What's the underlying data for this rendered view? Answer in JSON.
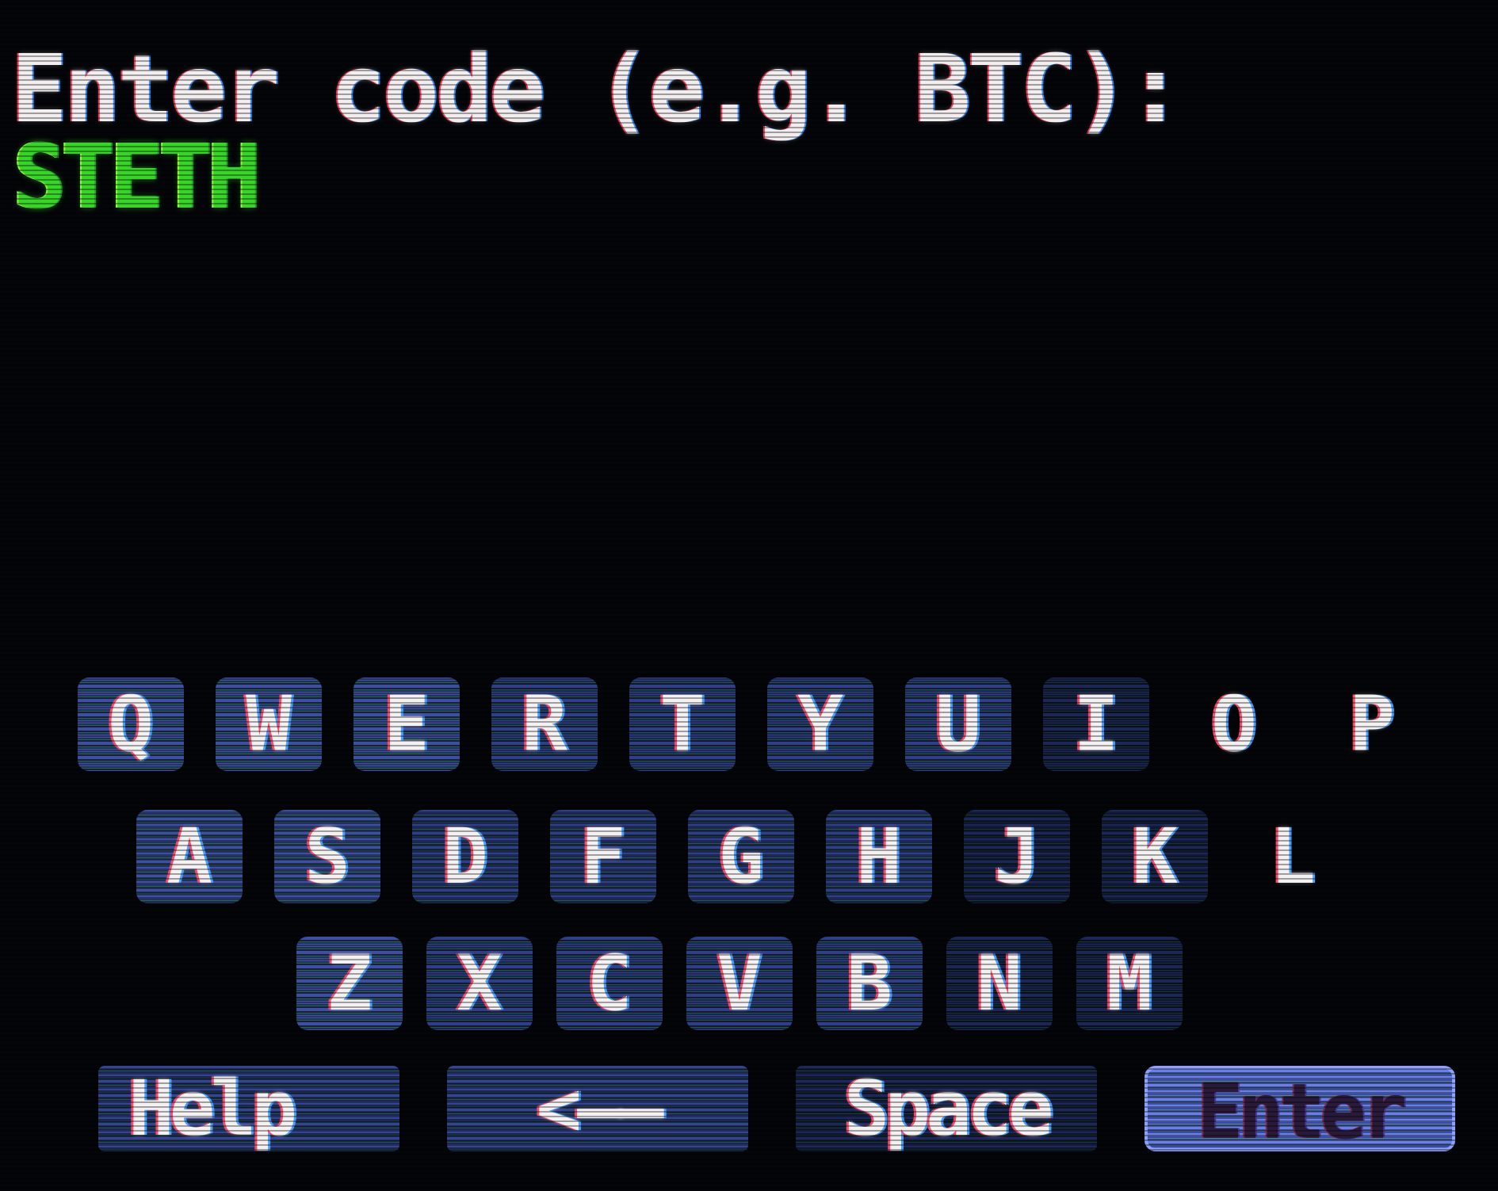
{
  "prompt": {
    "label": "Enter code (e.g. BTC):",
    "value": "STETH"
  },
  "keyboard": {
    "rows": [
      [
        "Q",
        "W",
        "E",
        "R",
        "T",
        "Y",
        "U",
        "I",
        "O",
        "P"
      ],
      [
        "A",
        "S",
        "D",
        "F",
        "G",
        "H",
        "J",
        "K",
        "L"
      ],
      [
        "Z",
        "X",
        "C",
        "V",
        "B",
        "N",
        "M"
      ]
    ],
    "function_keys": {
      "help": "Help",
      "backspace": "<——",
      "space": "Space",
      "enter": "Enter"
    },
    "selected_key": "Enter"
  },
  "colors": {
    "background": "#040508",
    "prompt_text": "#f2eef0",
    "input_text": "#39d42a",
    "key_fill": "#2f3f86",
    "selected_key_fill": "#6b7fe0"
  }
}
